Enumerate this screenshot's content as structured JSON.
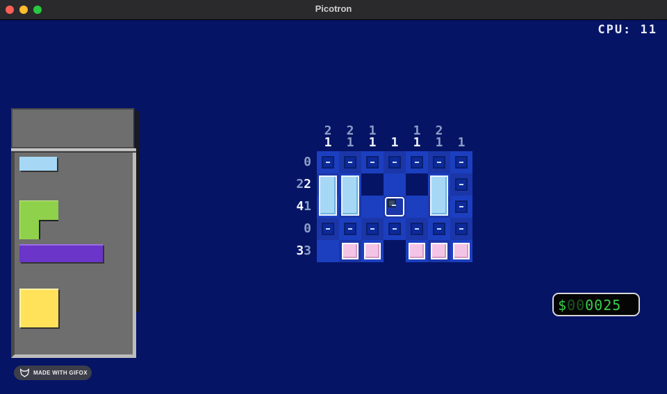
{
  "window": {
    "title": "Picotron"
  },
  "hud": {
    "cpu": "CPU: 11",
    "money": {
      "prefix": "$",
      "ghost": "00",
      "value": "0025"
    }
  },
  "tray": {
    "pieces": [
      {
        "name": "light-blue-bar-piece",
        "color": "#a6d8f6"
      },
      {
        "name": "green-l-piece",
        "color": "#8fd14a"
      },
      {
        "name": "purple-bar-piece",
        "color": "#6a35c8"
      },
      {
        "name": "yellow-square-piece",
        "color": "#ffe25a"
      }
    ]
  },
  "board": {
    "col_clues": [
      {
        "top": "2",
        "bottom": "1"
      },
      {
        "top": "2",
        "bottom": "1"
      },
      {
        "top": "1",
        "bottom": "1"
      },
      {
        "top": "",
        "bottom": "1"
      },
      {
        "top": "1",
        "bottom": "1"
      },
      {
        "top": "2",
        "bottom": "1"
      },
      {
        "top": "",
        "bottom": "1"
      }
    ],
    "row_clues": [
      {
        "first": "",
        "second": "0"
      },
      {
        "first": "2",
        "second": "2"
      },
      {
        "first": "4",
        "second": "1"
      },
      {
        "first": "",
        "second": "0"
      },
      {
        "first": "3",
        "second": "3"
      }
    ]
  },
  "badge": {
    "label": "MADE WITH GIFOX"
  },
  "colors": {
    "background": "#061466",
    "cell_light": "#1c3fc0",
    "cell_dark": "#1a36a8",
    "money_text": "#37d04a"
  }
}
